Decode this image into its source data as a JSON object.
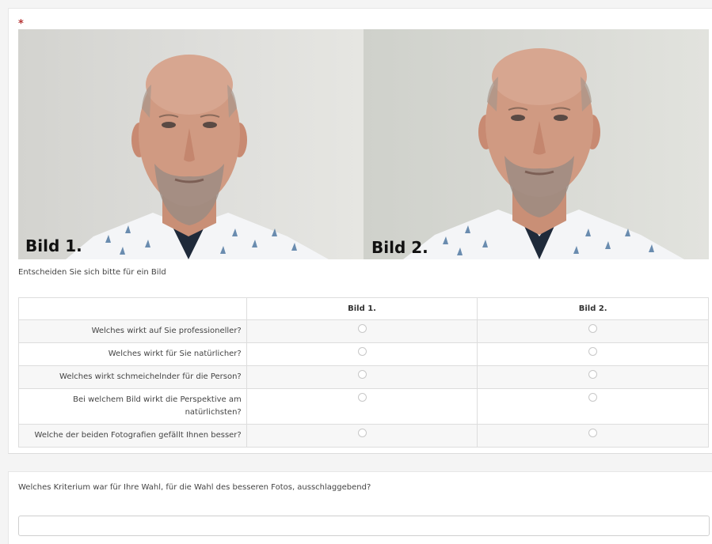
{
  "question": {
    "required_marker": "*",
    "photos": [
      {
        "caption": "Bild 1."
      },
      {
        "caption": "Bild 2."
      }
    ],
    "instruction": "Entscheiden Sie sich bitte für ein Bild",
    "matrix": {
      "columns": [
        "",
        "Bild 1.",
        "Bild 2."
      ],
      "rows": [
        "Welches wirkt auf Sie professioneller?",
        "Welches wirkt für Sie natürlicher?",
        "Welches wirkt schmeichelnder für die Person?",
        "Bei welchem Bild wirkt die Perspektive am natürlichsten?",
        "Welche der beiden Fotografien gefällt Ihnen besser?"
      ]
    }
  },
  "text_question": {
    "label": "Welches Kriterium war für Ihre Wahl, für die Wahl des besseren Fotos, ausschlaggebend?",
    "value": "",
    "placeholder": ""
  },
  "colors": {
    "required": "#b53434",
    "row_alt": "#f7f7f7",
    "border": "#dddddd"
  }
}
